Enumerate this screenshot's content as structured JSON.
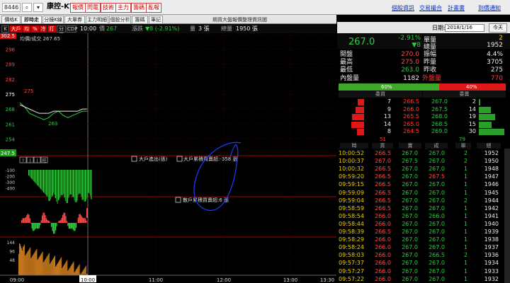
{
  "toolbar": {
    "symbol_code": "8446",
    "stock_name": "康控-KY",
    "buttons": [
      "報價",
      "閃電",
      "技術",
      "主力",
      "籌碼",
      "亂報"
    ],
    "links": [
      "個股資訊",
      "交易撮合",
      "計畫書",
      "到價通知"
    ]
  },
  "tabs": [
    "價格K線",
    "即時走勢",
    "分鐘K線",
    "大單券商",
    "主力明細",
    "個股分析",
    "籌碼",
    "筆記"
  ],
  "tab_caption": "期貨大盤報價整理資訊圖",
  "subbar": {
    "buttons": [
      "K線",
      "大戶",
      "均",
      "%",
      "冷",
      "打",
      "分價",
      "CDP"
    ],
    "time": "10:00",
    "price_label": "價",
    "price": "267",
    "change_label": "漲跌",
    "change": "▼8 (-2.91%)",
    "volume_label": "量",
    "volume": "3 張",
    "total_label": "總量",
    "total": "1950 張"
  },
  "chart_data": [
    {
      "type": "line",
      "title": "均價/成交 267.65",
      "ylim": [
        247.5,
        302.5
      ],
      "y_ticks": [
        "302.5",
        "296",
        "289",
        "282",
        "275",
        "268",
        "261",
        "254",
        "247.5"
      ],
      "x_ticks": [
        "09:00",
        "10:00",
        "11:00",
        "12:00",
        "13:00",
        "13:30"
      ],
      "series": [
        {
          "values": [
            271,
            269,
            266,
            265,
            264,
            263,
            264,
            266,
            267,
            265,
            264,
            265,
            266,
            267,
            267
          ]
        },
        {
          "values": [
            270,
            269,
            268,
            267,
            266,
            266,
            266,
            267,
            267,
            267,
            267,
            267,
            267,
            268,
            268
          ]
        }
      ],
      "annotations": [
        {
          "x": "09:00",
          "y": 275,
          "text": "275"
        },
        {
          "x": "09:20",
          "y": 263,
          "text": "263"
        }
      ]
    },
    {
      "type": "bar",
      "title": "大戶進出(張)",
      "annotation": "大戶累積買賣超:-358 張",
      "y_ticks": [
        "-100",
        "-200",
        "-300",
        "-400"
      ]
    },
    {
      "type": "bar",
      "title": "散戶累積買賣超:6 張"
    },
    {
      "type": "bar",
      "y_ticks": [
        "144",
        "96",
        "48"
      ]
    }
  ],
  "quote": {
    "date_label": "日期:",
    "date": "2018/1/16",
    "today": "今天",
    "price": "267.0",
    "change_pct": "-2.91%",
    "change": "▼8",
    "unit_label": "單量",
    "unit": "2",
    "total_label": "總量",
    "total": "1952",
    "rows": [
      {
        "a": "開盤",
        "b": "270.0",
        "c": "振幅",
        "d": "4.4%"
      },
      {
        "a": "最高",
        "b": "275.0",
        "c": "昨量",
        "d": "3705"
      },
      {
        "a": "最低",
        "b": "263.0",
        "c": "昨收",
        "d": "275"
      }
    ],
    "inner_label": "內盤量",
    "inner": "1182",
    "outer_label": "外盤量",
    "outer": "770",
    "inner_pct": "60%",
    "outer_pct": "40%",
    "inner_frac": 0.6
  },
  "book": {
    "hdr": [
      "委買",
      "委賣"
    ],
    "rows": [
      {
        "bq": "7",
        "bp": "266.5",
        "ap": "267.0",
        "aq": "2"
      },
      {
        "bq": "9",
        "bp": "266.0",
        "ap": "267.5",
        "aq": "14"
      },
      {
        "bq": "13",
        "bp": "265.5",
        "ap": "268.0",
        "aq": "19"
      },
      {
        "bq": "14",
        "bp": "265.0",
        "ap": "268.5",
        "aq": "15"
      },
      {
        "bq": "8",
        "bp": "264.5",
        "ap": "269.0",
        "aq": "30"
      }
    ],
    "bid_total": "51",
    "ask_total": "79"
  },
  "ticks_header": [
    "時",
    "買",
    "賣",
    "成",
    "單",
    "總"
  ],
  "ticks": [
    [
      "10:00:52",
      "266.5",
      "267.0",
      "267.0",
      "2",
      "1952"
    ],
    [
      "10:00:37",
      "267.0",
      "267.5",
      "267.0",
      "2",
      "1950"
    ],
    [
      "10:00:32",
      "266.5",
      "267.0",
      "267.0",
      "1",
      "1948"
    ],
    [
      "09:59:20",
      "266.5",
      "267.0",
      "267.5",
      "1",
      "1947"
    ],
    [
      "09:59:15",
      "266.5",
      "267.0",
      "267.0",
      "1",
      "1946"
    ],
    [
      "09:59:09",
      "266.5",
      "267.0",
      "267.0",
      "1",
      "1945"
    ],
    [
      "09:59:04",
      "266.5",
      "267.0",
      "267.0",
      "2",
      "1944"
    ],
    [
      "09:58:59",
      "266.5",
      "267.0",
      "267.0",
      "1",
      "1942"
    ],
    [
      "09:58:54",
      "266.0",
      "267.0",
      "266.0",
      "1",
      "1941"
    ],
    [
      "09:58:44",
      "266.0",
      "267.0",
      "267.0",
      "1",
      "1940"
    ],
    [
      "09:58:39",
      "266.5",
      "267.0",
      "267.0",
      "1",
      "1939"
    ],
    [
      "09:58:29",
      "266.0",
      "267.0",
      "267.0",
      "1",
      "1938"
    ],
    [
      "09:58:24",
      "266.0",
      "267.0",
      "267.0",
      "1",
      "1937"
    ],
    [
      "09:58:03",
      "266.0",
      "267.0",
      "266.5",
      "2",
      "1936"
    ],
    [
      "09:57:37",
      "266.0",
      "267.0",
      "267.0",
      "1",
      "1934"
    ],
    [
      "09:57:27",
      "266.0",
      "267.0",
      "267.0",
      "1",
      "1933"
    ],
    [
      "09:57:22",
      "266.0",
      "267.0",
      "267.0",
      "1",
      "1932"
    ]
  ]
}
